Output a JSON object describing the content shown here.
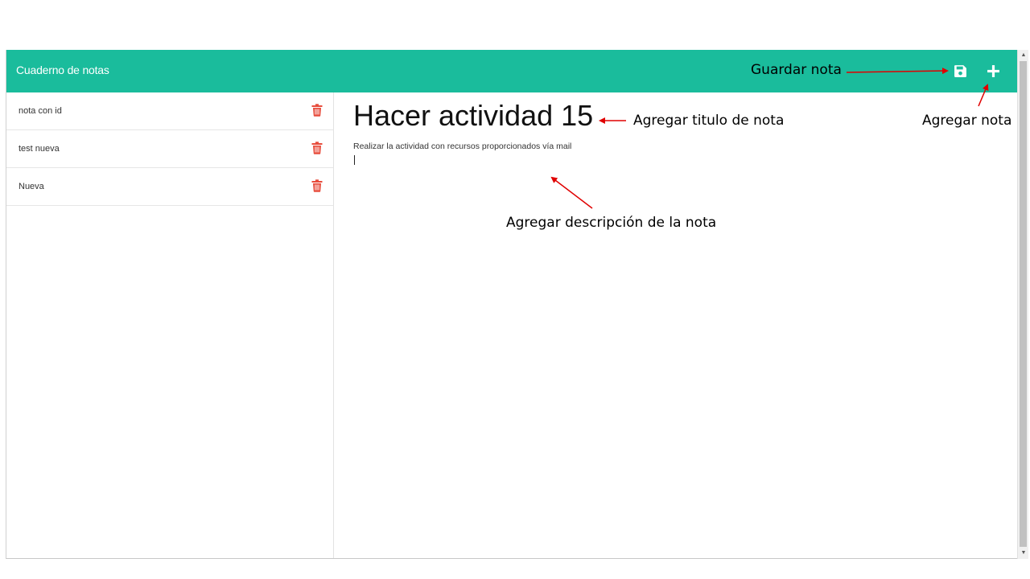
{
  "app": {
    "title": "Cuaderno de notas"
  },
  "toolbar": {
    "save_icon": "floppy-disk-icon",
    "add_icon": "plus-icon"
  },
  "sidebar": {
    "items": [
      {
        "label": "nota con id"
      },
      {
        "label": "test nueva"
      },
      {
        "label": "Nueva"
      }
    ],
    "delete_icon": "trash-icon"
  },
  "editor": {
    "title": "Hacer actividad 15",
    "description": "Realizar la actividad con recursos proporcionados vía mail"
  },
  "annotations": {
    "save": "Guardar nota",
    "title": "Agregar titulo de nota",
    "add": "Agregar nota",
    "description": "Agregar descripción de la nota"
  },
  "colors": {
    "accent": "#1abc9c",
    "delete": "#e74c3c",
    "annotation_arrow": "#e00000"
  }
}
